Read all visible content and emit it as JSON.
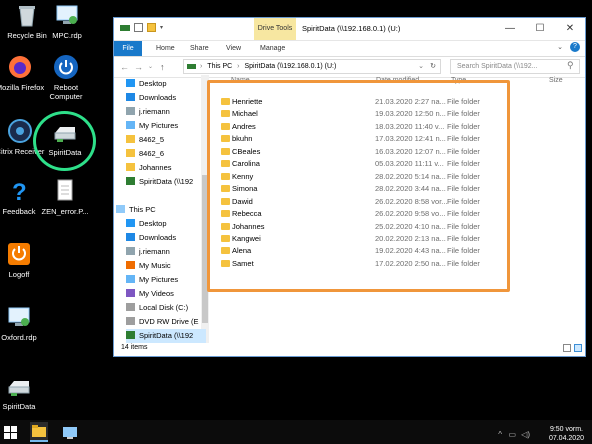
{
  "desktop": {
    "icons": [
      {
        "label": "Recycle Bin"
      },
      {
        "label": "MPC.rdp"
      },
      {
        "label": "Mozilla Firefox"
      },
      {
        "label": "Reboot Computer"
      },
      {
        "label": "Citrix Receiver"
      },
      {
        "label": "SpiritData"
      },
      {
        "label": "Feedback"
      },
      {
        "label": "ZEN_error.P..."
      },
      {
        "label": "Logoff"
      },
      {
        "label": "Oxford.rdp"
      },
      {
        "label": "SpiritData"
      }
    ]
  },
  "window": {
    "title": "SpiritData (\\\\192.168.0.1) (U:)",
    "context_tab": "Drive Tools",
    "controls": {
      "minimize": "—",
      "maximize": "☐",
      "close": "✕"
    },
    "ribbon_tabs": [
      "File",
      "Home",
      "Share",
      "View",
      "Manage"
    ],
    "address": {
      "segments": [
        "This PC",
        "SpiritData (\\\\192.168.0.1) (U:)"
      ],
      "separator": "›",
      "search_placeholder": "Search SpiritData (\\\\192..."
    },
    "columns": {
      "name": "Name",
      "date": "Date modified",
      "type": "Type",
      "size": "Size"
    },
    "nav_pane": [
      {
        "label": "Desktop",
        "pinned": true
      },
      {
        "label": "Downloads",
        "pinned": true
      },
      {
        "label": "j.riemann",
        "pinned": true
      },
      {
        "label": "My Pictures",
        "pinned": true
      },
      {
        "label": "8462_5",
        "pinned": false
      },
      {
        "label": "8462_6",
        "pinned": false
      },
      {
        "label": "Johannes",
        "pinned": false
      },
      {
        "label": "SpiritData (\\\\192",
        "pinned": false
      },
      {
        "label": "This PC",
        "pinned": false
      },
      {
        "label": "Desktop",
        "pinned": false
      },
      {
        "label": "Downloads",
        "pinned": false
      },
      {
        "label": "j.riemann",
        "pinned": false
      },
      {
        "label": "My Music",
        "pinned": false
      },
      {
        "label": "My Pictures",
        "pinned": false
      },
      {
        "label": "My Videos",
        "pinned": false
      },
      {
        "label": "Local Disk (C:)",
        "pinned": false
      },
      {
        "label": "DVD RW Drive (E",
        "pinned": false
      },
      {
        "label": "SpiritData (\\\\192",
        "pinned": false
      }
    ],
    "files": [
      {
        "name": "Henriette",
        "date": "21.03.2020 2:27 na...",
        "type": "File folder"
      },
      {
        "name": "Michael",
        "date": "19.03.2020 12:50 n...",
        "type": "File folder"
      },
      {
        "name": "Andres",
        "date": "18.03.2020 11:40 v...",
        "type": "File folder"
      },
      {
        "name": "bkuhn",
        "date": "17.03.2020 12:41 n...",
        "type": "File folder"
      },
      {
        "name": "CBeales",
        "date": "16.03.2020 12:07 n...",
        "type": "File folder"
      },
      {
        "name": "Carolina",
        "date": "05.03.2020 11:11 v...",
        "type": "File folder"
      },
      {
        "name": "Kenny",
        "date": "28.02.2020 5:14 na...",
        "type": "File folder"
      },
      {
        "name": "Simona",
        "date": "28.02.2020 3:44 na...",
        "type": "File folder"
      },
      {
        "name": "Dawid",
        "date": "26.02.2020 8:58 vor...",
        "type": "File folder"
      },
      {
        "name": "Rebecca",
        "date": "26.02.2020 9:58 vo...",
        "type": "File folder"
      },
      {
        "name": "Johannes",
        "date": "25.02.2020 4:10 na...",
        "type": "File folder"
      },
      {
        "name": "Kangwei",
        "date": "20.02.2020 2:13 na...",
        "type": "File folder"
      },
      {
        "name": "Alena",
        "date": "19.02.2020 4:43 na...",
        "type": "File folder"
      },
      {
        "name": "Samet",
        "date": "17.02.2020 2:50 na...",
        "type": "File folder"
      }
    ],
    "status": "14 items"
  },
  "taskbar": {
    "time": "9:50 vorm.",
    "date": "07.04.2020"
  },
  "colors": {
    "highlight_circle": "#2ee08a",
    "highlight_box": "#f0963b",
    "file_tab": "#1979ca",
    "drive_tools": "#f7e7a1",
    "folder": "#f5c23e"
  }
}
